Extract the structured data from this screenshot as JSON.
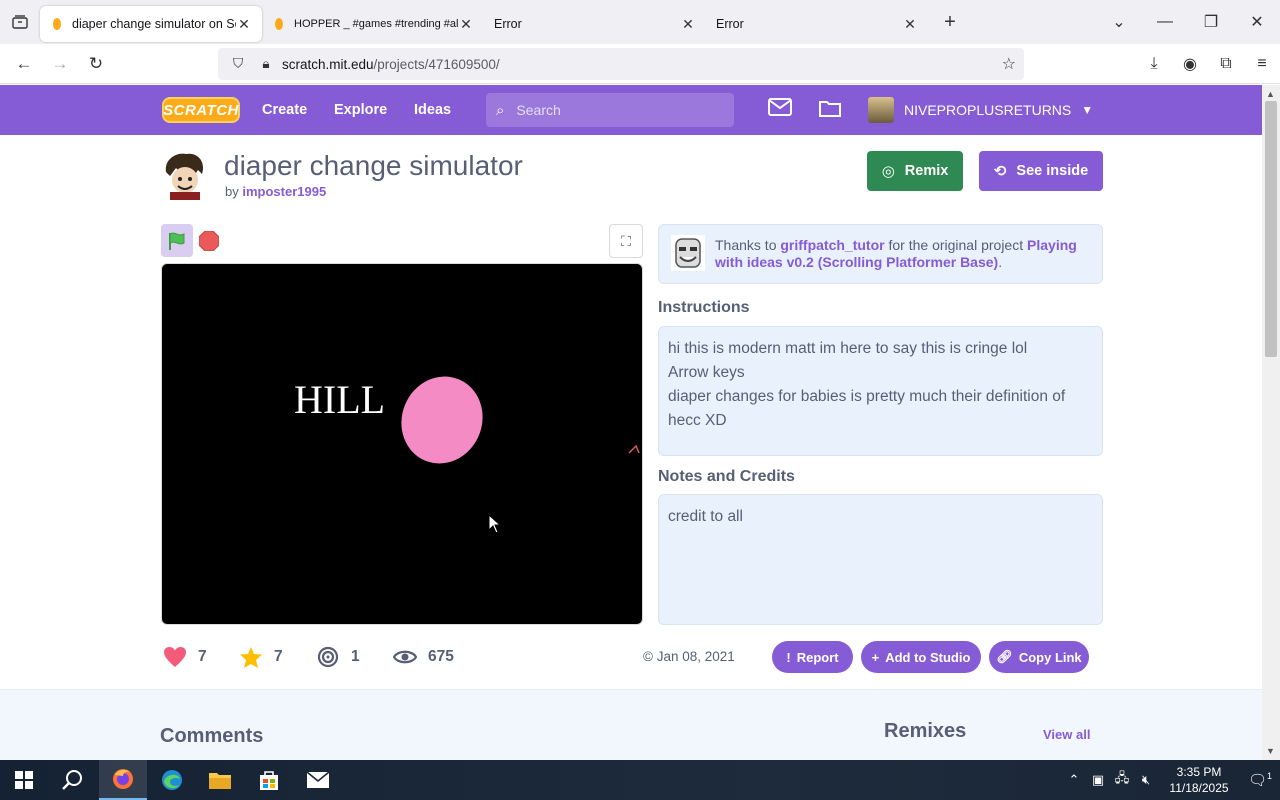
{
  "browser": {
    "tabs": [
      {
        "title": "diaper change simulator on Scr",
        "active": true
      },
      {
        "title": "HOPPER _ #games #trending #all",
        "active": false
      },
      {
        "title": "Error",
        "active": false
      },
      {
        "title": "Error",
        "active": false
      }
    ],
    "url_host": "scratch.mit.edu",
    "url_path": "/projects/471609500/"
  },
  "scratch_header": {
    "logo": "SCRATCH",
    "nav": [
      "Create",
      "Explore",
      "Ideas"
    ],
    "search_placeholder": "Search",
    "username": "NIVEPROPLUSRETURNS"
  },
  "project": {
    "title": "diaper change simulator",
    "by_label": "by",
    "author": "imposter1995",
    "remix_label": "Remix",
    "see_inside_label": "See inside"
  },
  "stage": {
    "text": "HILL"
  },
  "credit": {
    "prefix": "Thanks to",
    "user": "griffpatch_tutor",
    "middle": "for the original project",
    "project": "Playing with ideas v0.2 (Scrolling Platformer Base)",
    "suffix": "."
  },
  "instructions": {
    "heading": "Instructions",
    "lines": [
      "hi this is modern matt im here to say this is cringe lol",
      "Arrow keys",
      "diaper changes for babies is pretty much their definition of hecc XD"
    ]
  },
  "notes": {
    "heading": "Notes and Credits",
    "text": "credit to all"
  },
  "stats": {
    "loves": "7",
    "favorites": "7",
    "remixes": "1",
    "views": "675",
    "shared_date": "© Jan 08, 2021"
  },
  "actions": {
    "report": "Report",
    "add_to_studio": "Add to Studio",
    "copy_link": "Copy Link"
  },
  "lower": {
    "comments_heading": "Comments",
    "remixes_heading": "Remixes",
    "view_all": "View all"
  },
  "taskbar": {
    "time": "3:35 PM",
    "date": "11/18/2025",
    "notification_count": "1"
  },
  "colors": {
    "scratch_purple": "#855cd6",
    "remix_green": "#2e8a52",
    "love_pink": "#f45b79",
    "favorite_yellow": "#ffbf00"
  }
}
